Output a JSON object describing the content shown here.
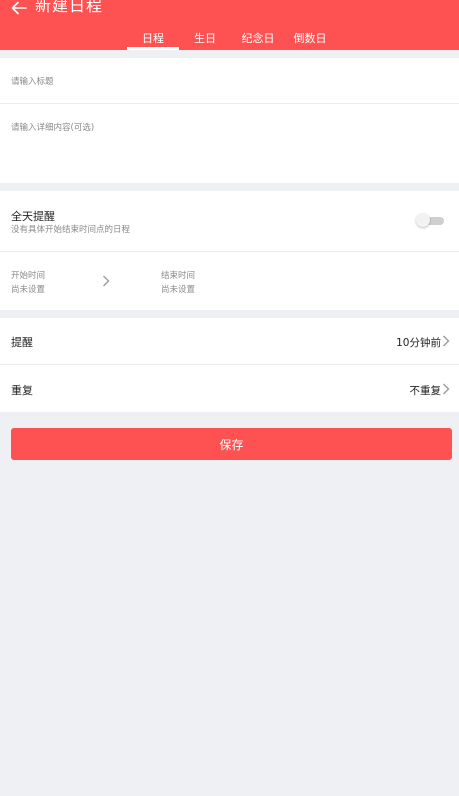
{
  "colors": {
    "accent": "#fe5252",
    "background": "#eff0f4",
    "card": "#ffffff",
    "placeholder": "#8a8a8a",
    "toggle_off": "#cfcfcf"
  },
  "header": {
    "title": "新建日程",
    "back_icon": "arrow-left-icon",
    "tabs": [
      {
        "label": "日程",
        "active": true
      },
      {
        "label": "生日",
        "active": false
      },
      {
        "label": "纪念日",
        "active": false
      },
      {
        "label": "倒数日",
        "active": false
      }
    ]
  },
  "form": {
    "title_placeholder": "请输入标题",
    "detail_placeholder": "请输入详细内容(可选)"
  },
  "all_day": {
    "label": "全天提醒",
    "description": "没有具体开始结束时间点的日程",
    "enabled": false
  },
  "time": {
    "start_label": "开始时间",
    "start_value": "尚未设置",
    "end_label": "结束时间",
    "end_value": "尚未设置"
  },
  "reminder": {
    "label": "提醒",
    "value": "10分钟前"
  },
  "repeat": {
    "label": "重复",
    "value": "不重复"
  },
  "save_label": "保存"
}
